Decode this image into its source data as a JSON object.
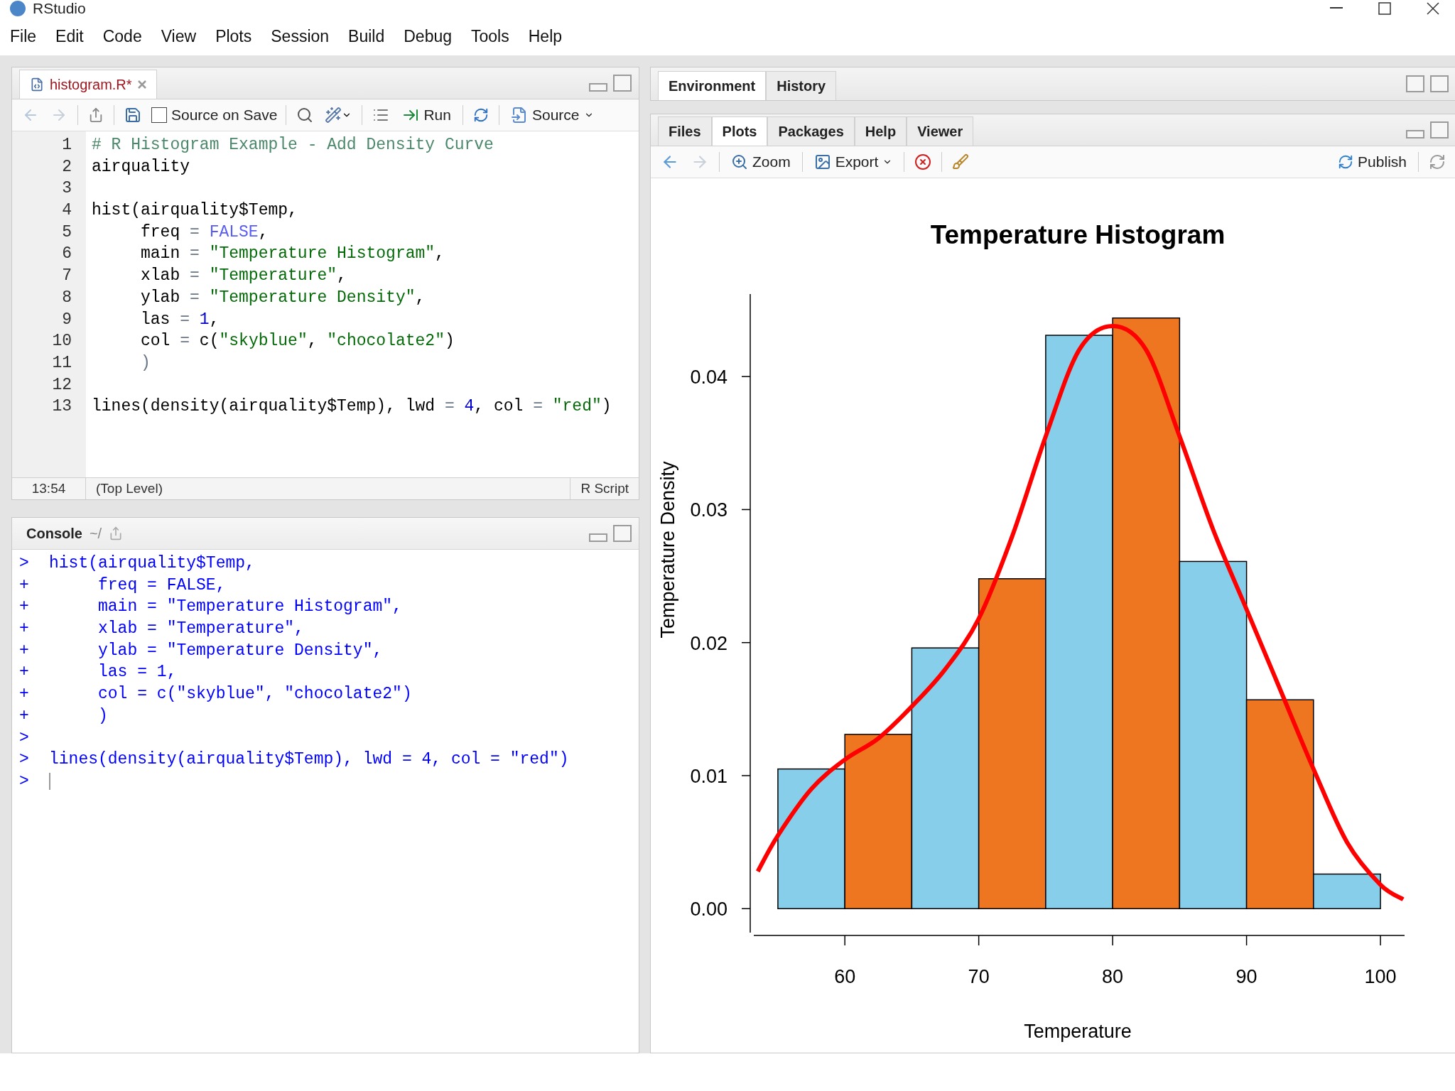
{
  "window": {
    "title": "RStudio"
  },
  "menu": [
    "File",
    "Edit",
    "Code",
    "View",
    "Plots",
    "Session",
    "Build",
    "Debug",
    "Tools",
    "Help"
  ],
  "editor": {
    "tabs": [
      {
        "label": "histogram.R*",
        "selected": true
      }
    ],
    "toolbar": {
      "source_on_save": {
        "label": "Source on Save",
        "checked": false
      },
      "run": "Run",
      "source": "Source"
    },
    "lines": [
      {
        "number": "1",
        "tokens": [
          {
            "kind": "comment",
            "text": "# R Histogram Example - Add Density Curve"
          }
        ]
      },
      {
        "number": "2",
        "tokens": [
          {
            "kind": "plain",
            "text": "airquality"
          }
        ]
      },
      {
        "number": "3"
      },
      {
        "number": "4",
        "tokens": [
          {
            "kind": "plain",
            "text": "hist(airquality$Temp,"
          }
        ]
      },
      {
        "number": "5",
        "tokens": [
          {
            "kind": "plain",
            "text": "     freq "
          },
          {
            "kind": "operator",
            "text": "= "
          },
          {
            "kind": "constant",
            "text": "FALSE"
          },
          {
            "kind": "plain",
            "text": ","
          }
        ]
      },
      {
        "number": "6",
        "tokens": [
          {
            "kind": "plain",
            "text": "     main "
          },
          {
            "kind": "operator",
            "text": "= "
          },
          {
            "kind": "string",
            "text": "\"Temperature Histogram\""
          },
          {
            "kind": "plain",
            "text": ","
          }
        ]
      },
      {
        "number": "7",
        "tokens": [
          {
            "kind": "plain",
            "text": "     xlab "
          },
          {
            "kind": "operator",
            "text": "= "
          },
          {
            "kind": "string",
            "text": "\"Temperature\""
          },
          {
            "kind": "plain",
            "text": ","
          }
        ]
      },
      {
        "number": "8",
        "tokens": [
          {
            "kind": "plain",
            "text": "     ylab "
          },
          {
            "kind": "operator",
            "text": "= "
          },
          {
            "kind": "string",
            "text": "\"Temperature Density\""
          },
          {
            "kind": "plain",
            "text": ","
          }
        ]
      },
      {
        "number": "9",
        "tokens": [
          {
            "kind": "plain",
            "text": "     las "
          },
          {
            "kind": "operator",
            "text": "= "
          },
          {
            "kind": "number",
            "text": "1"
          },
          {
            "kind": "plain",
            "text": ","
          }
        ]
      },
      {
        "number": "10",
        "tokens": [
          {
            "kind": "plain",
            "text": "     col "
          },
          {
            "kind": "operator",
            "text": "="
          },
          {
            "kind": "plain",
            "text": " c("
          },
          {
            "kind": "string",
            "text": "\"skyblue\""
          },
          {
            "kind": "plain",
            "text": ", "
          },
          {
            "kind": "string",
            "text": "\"chocolate2\""
          },
          {
            "kind": "plain",
            "text": ")"
          }
        ]
      },
      {
        "number": "11",
        "tokens": [
          {
            "kind": "operator",
            "text": "     )"
          }
        ]
      },
      {
        "number": "12"
      },
      {
        "number": "13",
        "tokens": [
          {
            "kind": "plain",
            "text": "lines(density(airquality$Temp), lwd "
          },
          {
            "kind": "operator",
            "text": "= "
          },
          {
            "kind": "number",
            "text": "4"
          },
          {
            "kind": "plain",
            "text": ", col "
          },
          {
            "kind": "operator",
            "text": "= "
          },
          {
            "kind": "string",
            "text": "\"red\""
          },
          {
            "kind": "plain",
            "text": ")"
          }
        ]
      }
    ],
    "status": {
      "position": "13:54",
      "scope": "(Top Level)",
      "file_type": "R Script"
    }
  },
  "console": {
    "title": "Console",
    "path": "~/",
    "lines": [
      {
        "prompt": ">",
        "text": "hist(airquality$Temp,"
      },
      {
        "prompt": "+",
        "text": "     freq = FALSE,"
      },
      {
        "prompt": "+",
        "text": "     main = \"Temperature Histogram\","
      },
      {
        "prompt": "+",
        "text": "     xlab = \"Temperature\","
      },
      {
        "prompt": "+",
        "text": "     ylab = \"Temperature Density\","
      },
      {
        "prompt": "+",
        "text": "     las = 1,"
      },
      {
        "prompt": "+",
        "text": "     col = c(\"skyblue\", \"chocolate2\")"
      },
      {
        "prompt": "+",
        "text": "     )"
      },
      {
        "prompt": ">"
      },
      {
        "prompt": ">",
        "text": "lines(density(airquality$Temp), lwd = 4, col = \"red\")"
      },
      {
        "prompt": ">"
      }
    ]
  },
  "top_right": {
    "tabs": [
      {
        "label": "Environment",
        "selected": true
      },
      {
        "label": "History",
        "selected": false
      }
    ]
  },
  "bottom_right": {
    "tabs": [
      {
        "label": "Files",
        "selected": false
      },
      {
        "label": "Plots",
        "selected": true
      },
      {
        "label": "Packages",
        "selected": false
      },
      {
        "label": "Help",
        "selected": false
      },
      {
        "label": "Viewer",
        "selected": false
      }
    ],
    "toolbar": {
      "zoom": "Zoom",
      "export": "Export",
      "publish": "Publish"
    },
    "chart_data": {
      "type": "bar",
      "title": "Temperature Histogram",
      "xlabel": "Temperature",
      "ylabel": "Temperature Density",
      "x": [
        57.5,
        62.5,
        67.5,
        72.5,
        77.5,
        82.5,
        87.5,
        92.5,
        97.5
      ],
      "series": [
        {
          "type": "bar",
          "colors": [
            "#87ceeb",
            "#ee7621",
            "#87ceeb",
            "#ee7621",
            "#87ceeb",
            "#ee7621",
            "#87ceeb",
            "#ee7621",
            "#87ceeb"
          ],
          "values": [
            0.0105,
            0.0131,
            0.0196,
            0.0248,
            0.0431,
            0.0444,
            0.0261,
            0.0157,
            0.0026
          ]
        },
        {
          "type": "line",
          "color": "#ff0000",
          "x": [
            53.5,
            55,
            57.5,
            60,
            62.5,
            65,
            67.5,
            70,
            72.5,
            75,
            77.5,
            80,
            82.5,
            85,
            87.5,
            90,
            92.5,
            95,
            97.5,
            100,
            101.7
          ],
          "values": [
            0.0028,
            0.0055,
            0.009,
            0.0112,
            0.0128,
            0.0152,
            0.018,
            0.0218,
            0.028,
            0.0355,
            0.042,
            0.0438,
            0.042,
            0.0355,
            0.0285,
            0.0225,
            0.0165,
            0.0105,
            0.005,
            0.0018,
            0.0007
          ]
        }
      ],
      "xlim": [
        53.2,
        101.8
      ],
      "ylim": [
        -0.0018,
        0.0462
      ],
      "xticks": [
        60,
        70,
        80,
        90,
        100
      ],
      "yticks": [
        {
          "value": 0,
          "label": "0.00"
        },
        {
          "value": 0.01,
          "label": "0.01"
        },
        {
          "value": 0.02,
          "label": "0.02"
        },
        {
          "value": 0.03,
          "label": "0.03"
        },
        {
          "value": 0.04,
          "label": "0.04"
        }
      ]
    }
  }
}
